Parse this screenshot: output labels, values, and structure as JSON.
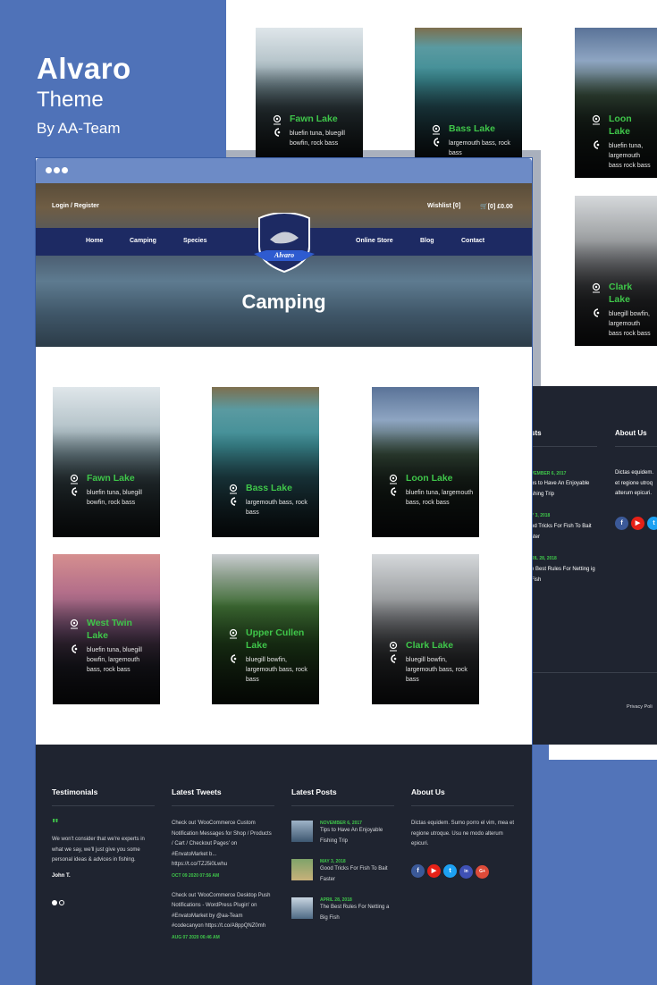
{
  "brand": {
    "title": "Alvaro",
    "subtitle": "Theme",
    "author": "By AA-Team"
  },
  "header": {
    "login": "Login / Register",
    "wishlist": "Wishlist [0]",
    "cart": "[0] £0.00",
    "nav": [
      "Home",
      "Camping",
      "Species",
      "Online Store",
      "Blog",
      "Contact"
    ],
    "logo_text": "Alvaro",
    "page_title": "Camping"
  },
  "lakes": [
    {
      "name": "Fawn Lake",
      "fish": "bluefin tuna, bluegill bowfin, rock bass"
    },
    {
      "name": "Bass Lake",
      "fish": "largemouth bass, rock bass"
    },
    {
      "name": "Loon Lake",
      "fish": "bluefin tuna, largemouth bass, rock bass"
    },
    {
      "name": "West Twin Lake",
      "fish": "bluefin tuna, bluegill bowfin, largemouth bass, rock bass"
    },
    {
      "name": "Upper Cullen Lake",
      "fish": "bluegill bowfin, largemouth bass, rock bass"
    },
    {
      "name": "Clark Lake",
      "fish": "bluegill bowfin, largemouth bass, rock bass"
    }
  ],
  "back_lakes": [
    {
      "name": "Fawn Lake",
      "fish": "bluefin tuna, bluegill bowfin, rock bass"
    },
    {
      "name": "Bass Lake",
      "fish": "largemouth bass, rock bass"
    },
    {
      "name": "Loon Lake",
      "fish": "bluefin tuna, largemouth bass rock bass"
    },
    {
      "name": "Clark Lake",
      "fish": "bluegill bowfin, largemouth bass rock bass"
    }
  ],
  "footer": {
    "testimonials": {
      "heading": "Testimonials",
      "quote": "We won't consider that we're experts in what we say, we'll just give you some personal ideas & advices in fishing.",
      "author": "John T."
    },
    "tweets": {
      "heading": "Latest Tweets",
      "items": [
        {
          "text": "Check out 'WooCommerce Custom Notification Messages for Shop / Products / Cart / Checkout Pages' on #EnvatoMarket b... https://t.co/TZJ5i0Lwhu",
          "date": "OCT 09 2020 07:56 AM"
        },
        {
          "text": "Check out 'WooCommerce Desktop Push Notifications - WordPress Plugin' on #EnvatoMarket by @aa-Team #codecanyon https://t.co/A8ppQNZ0mh",
          "date": "AUG 07 2020 06:46 AM"
        }
      ]
    },
    "posts": {
      "heading": "Latest Posts",
      "items": [
        {
          "date": "NOVEMBER 6, 2017",
          "title": "Tips to Have An Enjoyable Fishing Trip"
        },
        {
          "date": "MAY 3, 2018",
          "title": "Good Tricks For Fish To Bait Faster"
        },
        {
          "date": "APRIL 28, 2018",
          "title": "The Best Rules For Netting a Big Fish"
        }
      ]
    },
    "about": {
      "heading": "About Us",
      "text": "Dictas equidem. Sumo porro el vim, mea et regione utroque. Usu ne modo alterum epicuri.",
      "social": [
        "f",
        "▶",
        "t",
        "in",
        "G+"
      ]
    }
  },
  "back_footer": {
    "posts_heading_fragment": "sts",
    "about_heading": "About Us",
    "about_text": "Dictas equidem. et regione utroq alterum epicuri.",
    "post1_date": "VEMBER 6, 2017",
    "post1_title": "ps to Have An Enjoyable shing Trip",
    "post2_date": "Y 3, 2018",
    "post2_title": "od Tricks For Fish To Bait ster",
    "post3_date": "RIL 28, 2018",
    "post3_title": "e Best Rules For Netting ig Fish",
    "privacy": "Privacy Poli"
  },
  "colors": {
    "accent_green": "#3fc64a",
    "nav_blue": "#1d2a63",
    "footer_bg": "#1f2430",
    "brand_blue": "#4f72b8"
  }
}
